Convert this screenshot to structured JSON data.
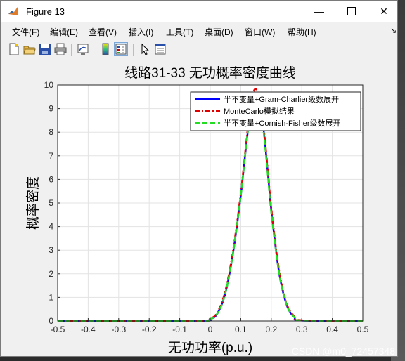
{
  "window": {
    "title": "Figure 13",
    "minimize_icon": "minimize-icon",
    "maximize_icon": "maximize-icon",
    "close_icon": "close-icon"
  },
  "menu": {
    "items": [
      "文件(F)",
      "编辑(E)",
      "查看(V)",
      "插入(I)",
      "工具(T)",
      "桌面(D)",
      "窗口(W)",
      "帮助(H)"
    ],
    "dock_arrow": "↘"
  },
  "toolbar": {
    "icons": [
      "new-figure-icon",
      "open-file-icon",
      "save-icon",
      "print-icon",
      "link-plot-icon",
      "insert-colorbar-icon",
      "insert-legend-icon",
      "edit-plot-arrow-icon",
      "property-inspector-icon"
    ]
  },
  "chart_data": {
    "type": "line",
    "title": "线路31-33 无功概率密度曲线",
    "xlabel": "无功功率(p.u.)",
    "ylabel": "概率密度",
    "xlim": [
      -0.5,
      0.5
    ],
    "ylim": [
      0,
      10
    ],
    "xticks": [
      -0.5,
      -0.4,
      -0.3,
      -0.2,
      -0.1,
      0,
      0.1,
      0.2,
      0.3,
      0.4,
      0.5
    ],
    "xticklabels": [
      "-0.5",
      "-0.4",
      "-0.3",
      "-0.2",
      "-0.1",
      "0",
      "0.1",
      "0.2",
      "0.3",
      "0.4",
      "0.5"
    ],
    "yticks": [
      0,
      1,
      2,
      3,
      4,
      5,
      6,
      7,
      8,
      9,
      10
    ],
    "yticklabels": [
      "0",
      "1",
      "2",
      "3",
      "4",
      "5",
      "6",
      "7",
      "8",
      "9",
      "10"
    ],
    "grid": true,
    "legend_position": "top-right",
    "x": [
      -0.5,
      -0.05,
      0.0,
      0.025,
      0.05,
      0.075,
      0.1,
      0.115,
      0.13,
      0.145,
      0.16,
      0.175,
      0.19,
      0.2,
      0.225,
      0.25,
      0.275,
      0.3,
      0.5
    ],
    "series": [
      {
        "name": "半不变量+Gram-Charlier级数展开",
        "color": "#0000ff",
        "style": "solid",
        "values": [
          0,
          0,
          0.08,
          0.35,
          1.2,
          2.9,
          5.3,
          7.1,
          8.7,
          9.6,
          9.4,
          8.1,
          6.1,
          4.7,
          2.1,
          0.7,
          0.17,
          0.02,
          0
        ]
      },
      {
        "name": "MonteCarlo模拟结果",
        "color": "#e00000",
        "style": "dashdot",
        "values": [
          0,
          0,
          0.1,
          0.4,
          1.3,
          3.0,
          5.4,
          7.2,
          8.9,
          9.8,
          9.5,
          8.2,
          6.2,
          4.8,
          2.2,
          0.75,
          0.2,
          0.03,
          0
        ]
      },
      {
        "name": "半不变量+Cornish-Fisher级数展开",
        "color": "#22dd22",
        "style": "dashed",
        "values": [
          0,
          0,
          0.08,
          0.35,
          1.2,
          2.9,
          5.3,
          7.1,
          8.7,
          9.5,
          9.3,
          8.0,
          6.0,
          4.6,
          2.1,
          0.7,
          0.17,
          0.02,
          0
        ]
      }
    ]
  },
  "watermark": "CSDN @m0_72457348"
}
